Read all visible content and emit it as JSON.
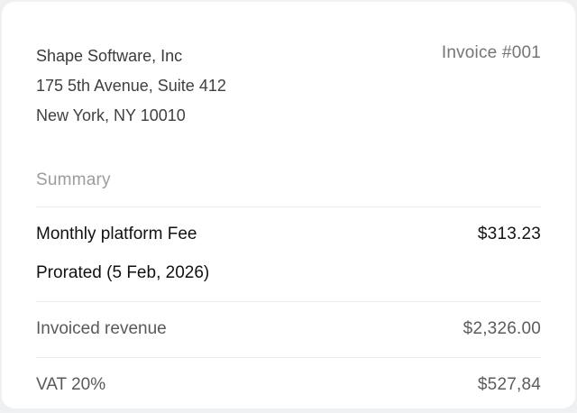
{
  "invoice": {
    "company": {
      "name": "Shape Software, Inc",
      "address_line1": "175 5th Avenue, Suite 412",
      "address_line2": "New York, NY 10010"
    },
    "invoice_number": "Invoice #001",
    "section_title": "Summary",
    "rows": [
      {
        "label": "Monthly platform Fee",
        "sublabel": "Prorated (5 Feb, 2026)",
        "amount": "$313.23"
      },
      {
        "label": "Invoiced revenue",
        "amount": "$2,326.00"
      },
      {
        "label": "VAT 20%",
        "amount": "$527,84"
      }
    ],
    "colors": {
      "card_background": "#ffffff",
      "page_background": "#eef0f1",
      "divider": "#ececec",
      "emphasis_text": "#111111",
      "muted_text": "#595959",
      "secondary_text": "#757575",
      "section_label_text": "#9c9c9c"
    }
  }
}
